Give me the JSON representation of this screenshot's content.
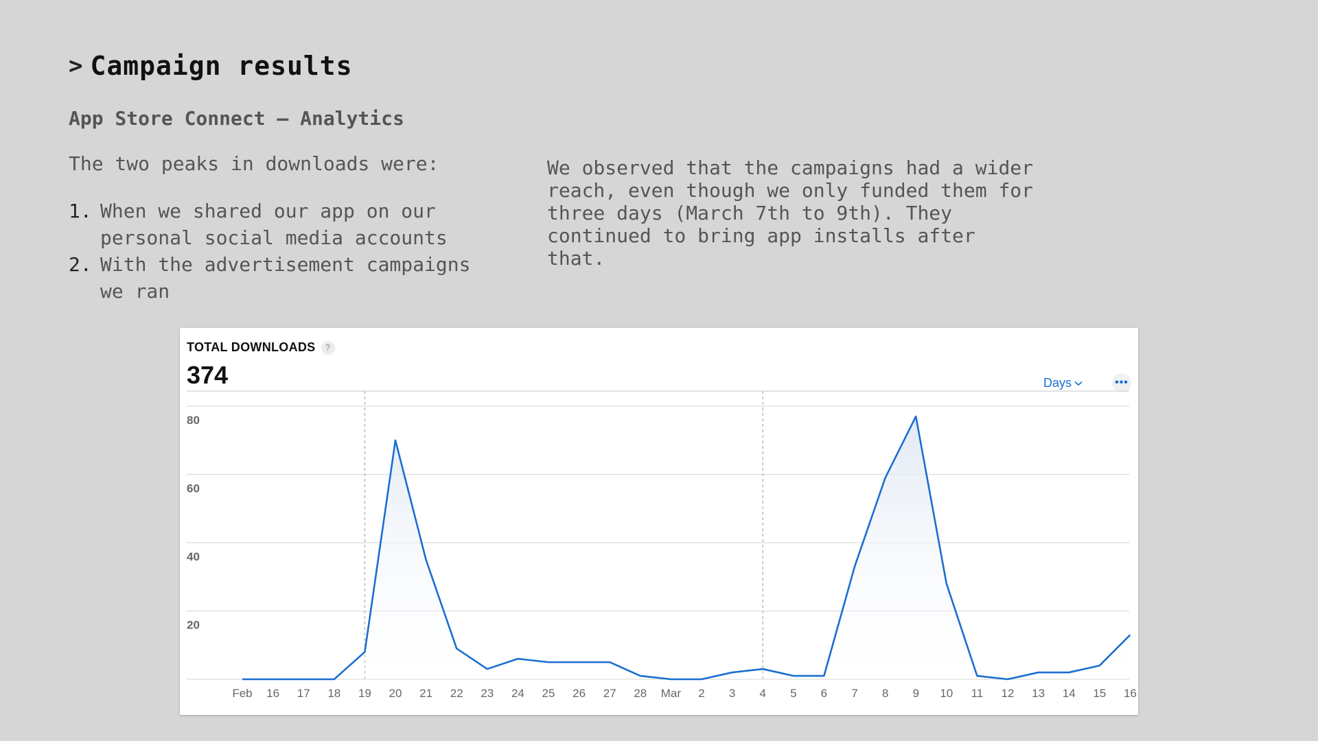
{
  "heading": {
    "chevron": ">",
    "title": "Campaign results"
  },
  "subtitle": "App Store Connect – Analytics",
  "intro": "The two peaks in downloads were:",
  "peaks": [
    {
      "num": "1.",
      "text": "When we shared our app on our personal social media accounts"
    },
    {
      "num": "2.",
      "text": "With the advertisement campaigns we ran"
    }
  ],
  "observation": "We observed that the campaigns had a wider reach, even though we only funded them for three days (March 7th to 9th). They continued to bring app installs after that.",
  "card": {
    "title": "TOTAL DOWNLOADS",
    "help": "?",
    "total": "374",
    "period_label": "Days",
    "more_label": "•••"
  },
  "colors": {
    "line": "#1a6ed0",
    "accent": "#1a6ed0",
    "grid": "#dddddd"
  },
  "chart_data": {
    "type": "area",
    "title": "TOTAL DOWNLOADS",
    "xlabel": "",
    "ylabel": "",
    "ylim": [
      0,
      80
    ],
    "yticks": [
      20,
      40,
      60,
      80
    ],
    "grid": true,
    "categories": [
      "Feb",
      "16",
      "17",
      "18",
      "19",
      "20",
      "21",
      "22",
      "23",
      "24",
      "25",
      "26",
      "27",
      "28",
      "Mar",
      "2",
      "3",
      "4",
      "5",
      "6",
      "7",
      "8",
      "9",
      "10",
      "11",
      "12",
      "13",
      "14",
      "15",
      "16"
    ],
    "values": [
      0,
      0,
      0,
      0,
      8,
      70,
      35,
      9,
      3,
      6,
      5,
      5,
      5,
      1,
      0,
      0,
      2,
      3,
      1,
      1,
      33,
      59,
      77,
      28,
      1,
      0,
      2,
      2,
      4,
      13
    ],
    "markers": [
      "19",
      "4"
    ]
  }
}
